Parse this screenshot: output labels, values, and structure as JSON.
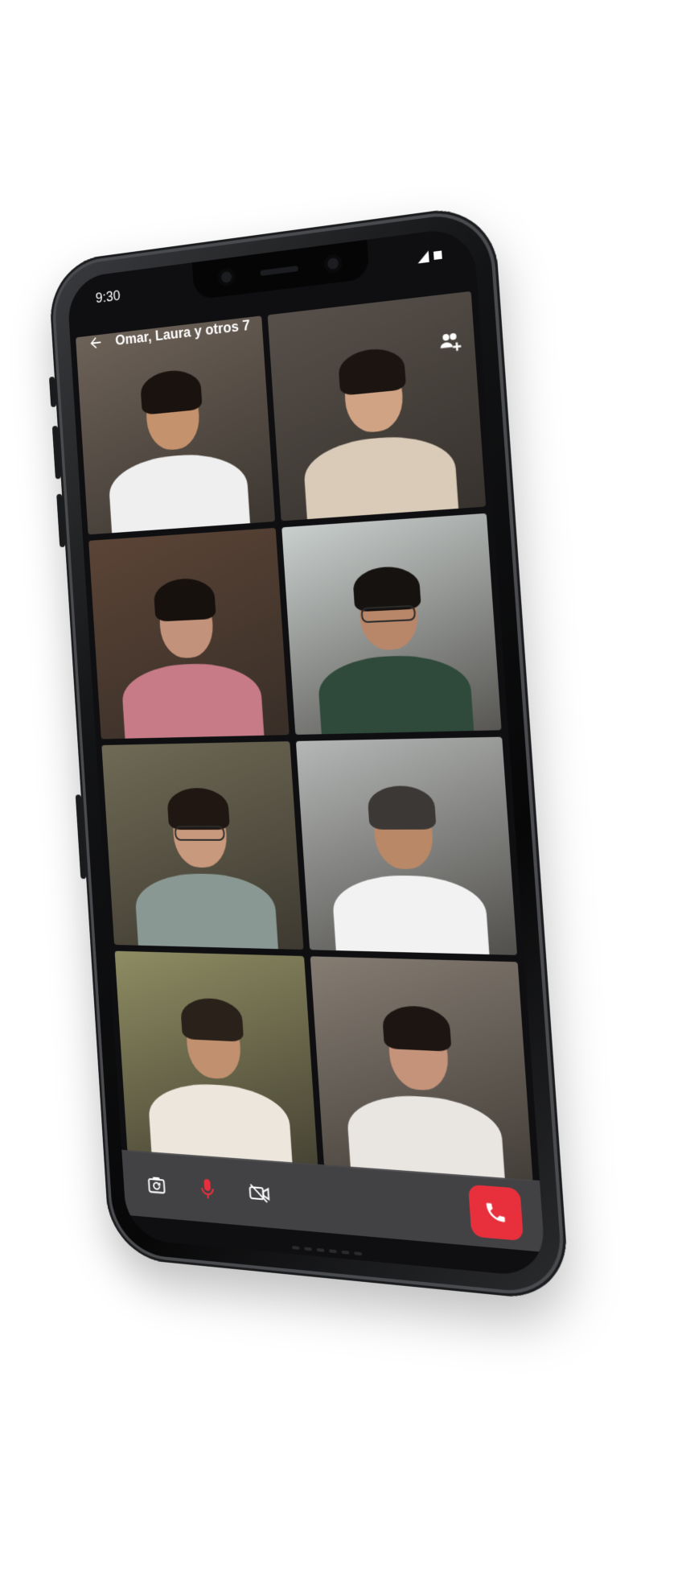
{
  "status_bar": {
    "time": "9:30"
  },
  "header": {
    "back_icon": "arrow-left-icon",
    "title": "Omar, Laura y otros 7",
    "add_people_icon": "add-people-icon"
  },
  "participants": [
    {
      "bg": "#6d6258",
      "skin": "#c4926c",
      "hair": "#1a120e",
      "shirt": "#efefef",
      "glasses": false
    },
    {
      "bg": "#57504a",
      "skin": "#d1a385",
      "hair": "#1b1411",
      "shirt": "#d9cbb8",
      "glasses": false
    },
    {
      "bg": "#5b4436",
      "skin": "#c3927a",
      "hair": "#17110d",
      "shirt": "#c67b86",
      "glasses": false
    },
    {
      "bg": "#c9cfcd",
      "skin": "#b8876a",
      "hair": "#151210",
      "shirt": "#2f4a3b",
      "glasses": true
    },
    {
      "bg": "#6f6a55",
      "skin": "#c8997c",
      "hair": "#201712",
      "shirt": "#8a9893",
      "glasses": true
    },
    {
      "bg": "#b4b7b6",
      "skin": "#b88867",
      "hair": "#3b3835",
      "shirt": "#f2f2f2",
      "glasses": false
    },
    {
      "bg": "#8e8c62",
      "skin": "#c0906f",
      "hair": "#2a211b",
      "shirt": "#ece6dc",
      "glasses": false
    },
    {
      "bg": "#857c72",
      "skin": "#c4937a",
      "hair": "#1c1512",
      "shirt": "#e9e6e2",
      "glasses": false
    }
  ],
  "controls": {
    "flip_camera_icon": "flip-camera-icon",
    "mic_icon": "microphone-icon",
    "video_off_icon": "video-off-icon",
    "end_call_icon": "phone-icon",
    "mic_color": "#e8303d",
    "end_call_color": "#e8303d"
  }
}
